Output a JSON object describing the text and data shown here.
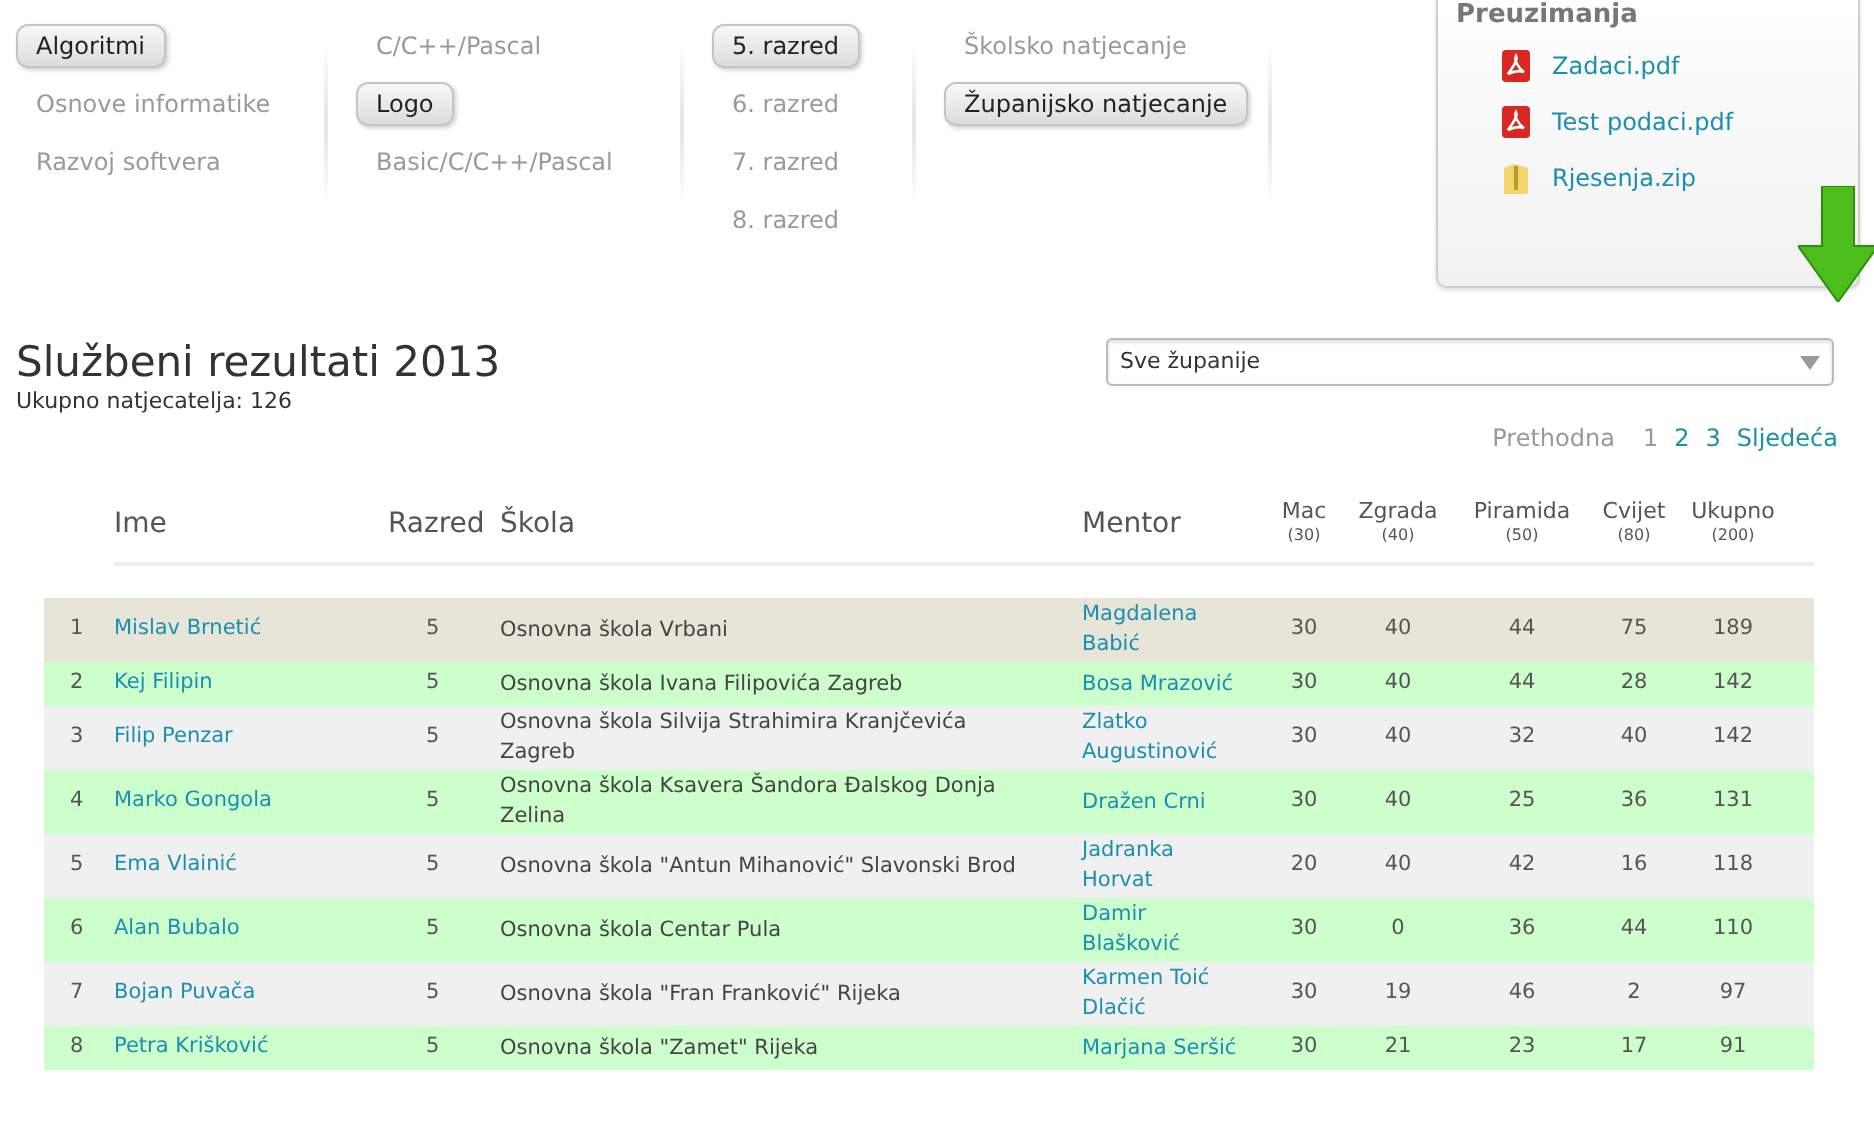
{
  "menu_columns": [
    {
      "items": [
        {
          "label": "Algoritmi",
          "selected": true
        },
        {
          "label": "Osnove informatike",
          "selected": false
        },
        {
          "label": "Razvoj softvera",
          "selected": false
        }
      ]
    },
    {
      "items": [
        {
          "label": "C/C++/Pascal",
          "selected": false
        },
        {
          "label": "Logo",
          "selected": true
        },
        {
          "label": "Basic/C/C++/Pascal",
          "selected": false
        }
      ]
    },
    {
      "items": [
        {
          "label": "5. razred",
          "selected": true
        },
        {
          "label": "6. razred",
          "selected": false
        },
        {
          "label": "7. razred",
          "selected": false
        },
        {
          "label": "8. razred",
          "selected": false
        }
      ]
    },
    {
      "items": [
        {
          "label": "Školsko natjecanje",
          "selected": false
        },
        {
          "label": "Županijsko natjecanje",
          "selected": true
        }
      ]
    }
  ],
  "downloads": {
    "title": "Preuzimanja",
    "files": [
      {
        "name": "Zadaci.pdf",
        "kind": "pdf"
      },
      {
        "name": "Test podaci.pdf",
        "kind": "pdf"
      },
      {
        "name": "Rjesenja.zip",
        "kind": "zip"
      }
    ]
  },
  "title": "Službeni rezultati 2013",
  "subtitle": "Ukupno natjecatelja: 126",
  "county_select": {
    "value": "Sve županije"
  },
  "pagination": {
    "previous": "Prethodna",
    "pages": [
      {
        "label": "1",
        "selected": true
      },
      {
        "label": "2",
        "selected": false
      },
      {
        "label": "3",
        "selected": false
      }
    ],
    "next": "Sljedeća"
  },
  "table": {
    "columns": [
      {
        "label": "Ime"
      },
      {
        "label": "Razred"
      },
      {
        "label": "Škola"
      },
      {
        "label": "Mentor"
      },
      {
        "label": "Mac",
        "max": "(30)"
      },
      {
        "label": "Zgrada",
        "max": "(40)"
      },
      {
        "label": "Piramida",
        "max": "(50)"
      },
      {
        "label": "Cvijet",
        "max": "(80)"
      },
      {
        "label": "Ukupno",
        "max": "(200)"
      }
    ],
    "rows": [
      {
        "rank": "1",
        "name": "Mislav Brnetić",
        "grade": "5",
        "school": "Osnovna škola Vrbani",
        "mentor": "Magdalena Babić",
        "scores": [
          "30",
          "40",
          "44",
          "75",
          "189"
        ],
        "color": "#e6e5d8"
      },
      {
        "rank": "2",
        "name": "Kej Filipin",
        "grade": "5",
        "school": "Osnovna škola Ivana Filipovića Zagreb",
        "mentor": "Bosa Mrazović",
        "scores": [
          "30",
          "40",
          "44",
          "28",
          "142"
        ],
        "color": "#ccffcc"
      },
      {
        "rank": "3",
        "name": "Filip Penzar",
        "grade": "5",
        "school": "Osnovna škola Silvija Strahimira Kranjčevića Zagreb",
        "mentor": "Zlatko Augustinović",
        "scores": [
          "30",
          "40",
          "32",
          "40",
          "142"
        ],
        "color": "#f0f0f0"
      },
      {
        "rank": "4",
        "name": "Marko Gongola",
        "grade": "5",
        "school": "Osnovna škola Ksavera Šandora Đalskog Donja Zelina",
        "mentor": "Dražen Crni",
        "scores": [
          "30",
          "40",
          "25",
          "36",
          "131"
        ],
        "color": "#ccffcc"
      },
      {
        "rank": "5",
        "name": "Ema Vlainić",
        "grade": "5",
        "school": "Osnovna škola \"Antun Mihanović\" Slavonski Brod",
        "mentor": "Jadranka Horvat",
        "scores": [
          "20",
          "40",
          "42",
          "16",
          "118"
        ],
        "color": "#f0f0f0"
      },
      {
        "rank": "6",
        "name": "Alan Bubalo",
        "grade": "5",
        "school": "Osnovna škola Centar Pula",
        "mentor": "Damir Blašković",
        "scores": [
          "30",
          "0",
          "36",
          "44",
          "110"
        ],
        "color": "#ccffcc"
      },
      {
        "rank": "7",
        "name": "Bojan Puvača",
        "grade": "5",
        "school": "Osnovna škola \"Fran Franković\" Rijeka",
        "mentor": "Karmen Toić Dlačić",
        "scores": [
          "30",
          "19",
          "46",
          "2",
          "97"
        ],
        "color": "#f0f0f0"
      },
      {
        "rank": "8",
        "name": "Petra Krišković",
        "grade": "5",
        "school": "Osnovna škola \"Zamet\" Rijeka",
        "mentor": "Marjana Seršić",
        "scores": [
          "30",
          "21",
          "23",
          "17",
          "91"
        ],
        "color": "#ccffcc"
      }
    ]
  }
}
